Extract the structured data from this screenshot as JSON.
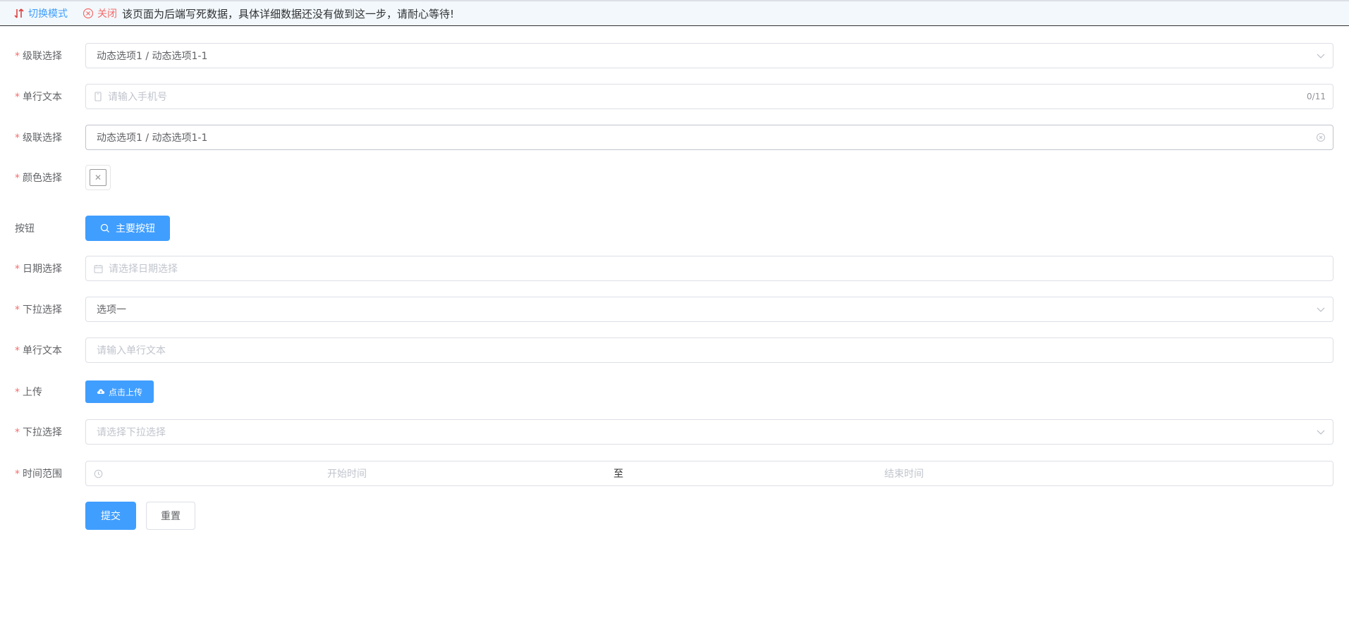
{
  "topbar": {
    "switch_label": "切换模式",
    "close_label": "关闭",
    "notice": "该页面为后端写死数据，具体详细数据还没有做到这一步，请耐心等待!"
  },
  "form": {
    "cascader1": {
      "label": "级联选择",
      "value": "动态选项1 / 动态选项1-1"
    },
    "text1": {
      "label": "单行文本",
      "placeholder": "请输入手机号",
      "counter": "0/11"
    },
    "cascader2": {
      "label": "级联选择",
      "value": "动态选项1 / 动态选项1-1"
    },
    "color": {
      "label": "颜色选择",
      "clear_glyph": "✕"
    },
    "button": {
      "label": "按钮",
      "text": "主要按钮"
    },
    "date": {
      "label": "日期选择",
      "placeholder": "请选择日期选择"
    },
    "select1": {
      "label": "下拉选择",
      "value": "选项一"
    },
    "text2": {
      "label": "单行文本",
      "placeholder": "请输入单行文本"
    },
    "upload": {
      "label": "上传",
      "button": "点击上传"
    },
    "select2": {
      "label": "下拉选择",
      "placeholder": "请选择下拉选择"
    },
    "timerange": {
      "label": "时间范围",
      "start": "开始时间",
      "separator": "至",
      "end": "结束时间"
    },
    "submit": "提交",
    "reset": "重置",
    "required_mark": "*"
  },
  "colors": {
    "primary": "#409eff",
    "danger": "#f56c6c",
    "border": "#dcdfe6",
    "placeholder": "#c0c4cc",
    "topbar_bg": "#f2f8fb"
  }
}
